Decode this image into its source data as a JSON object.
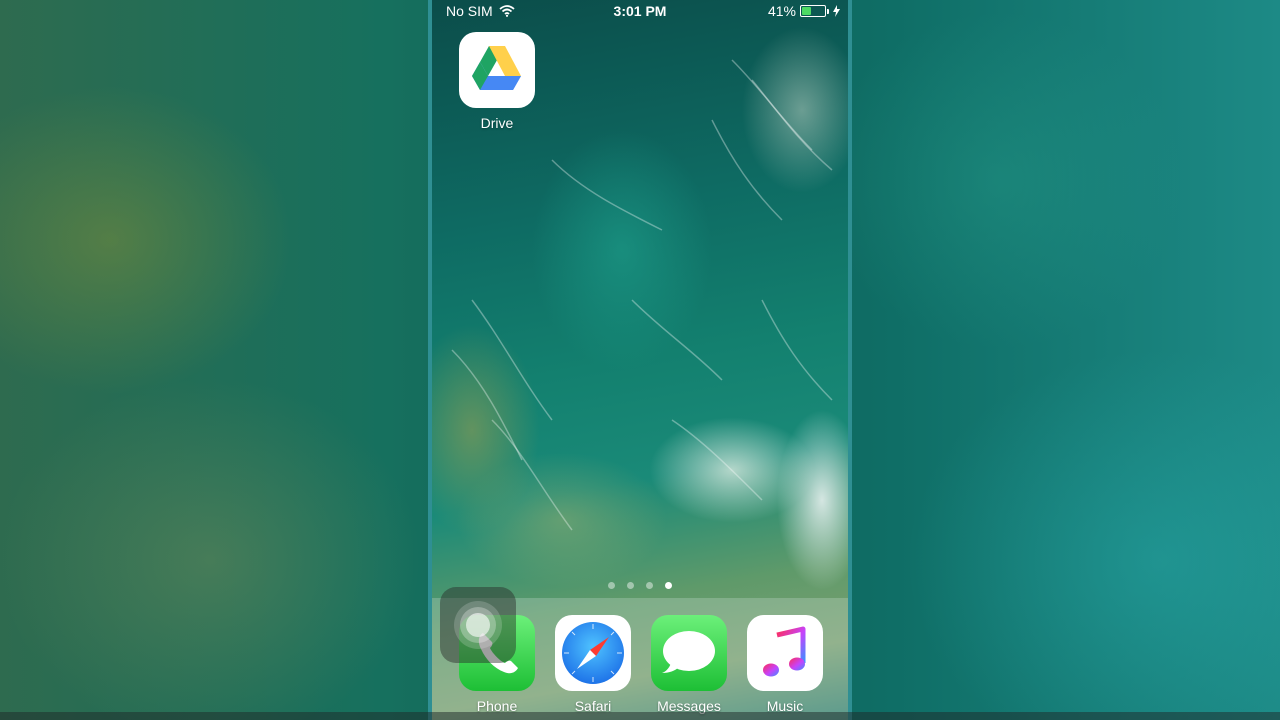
{
  "status_bar": {
    "carrier": "No SIM",
    "time": "3:01 PM",
    "battery_percent": "41%",
    "battery_level": 0.41,
    "battery_color": "#4cd964"
  },
  "home_apps": [
    {
      "label": "Drive",
      "icon": "google-drive-icon"
    }
  ],
  "page_indicator": {
    "pages": 4,
    "current": 4
  },
  "dock": {
    "apps": [
      {
        "label": "Phone",
        "icon": "phone-icon"
      },
      {
        "label": "Safari",
        "icon": "safari-compass-icon"
      },
      {
        "label": "Messages",
        "icon": "messages-bubble-icon"
      },
      {
        "label": "Music",
        "icon": "music-note-icon"
      }
    ]
  },
  "overlay": {
    "assistive_touch": "assistive-touch-icon"
  }
}
